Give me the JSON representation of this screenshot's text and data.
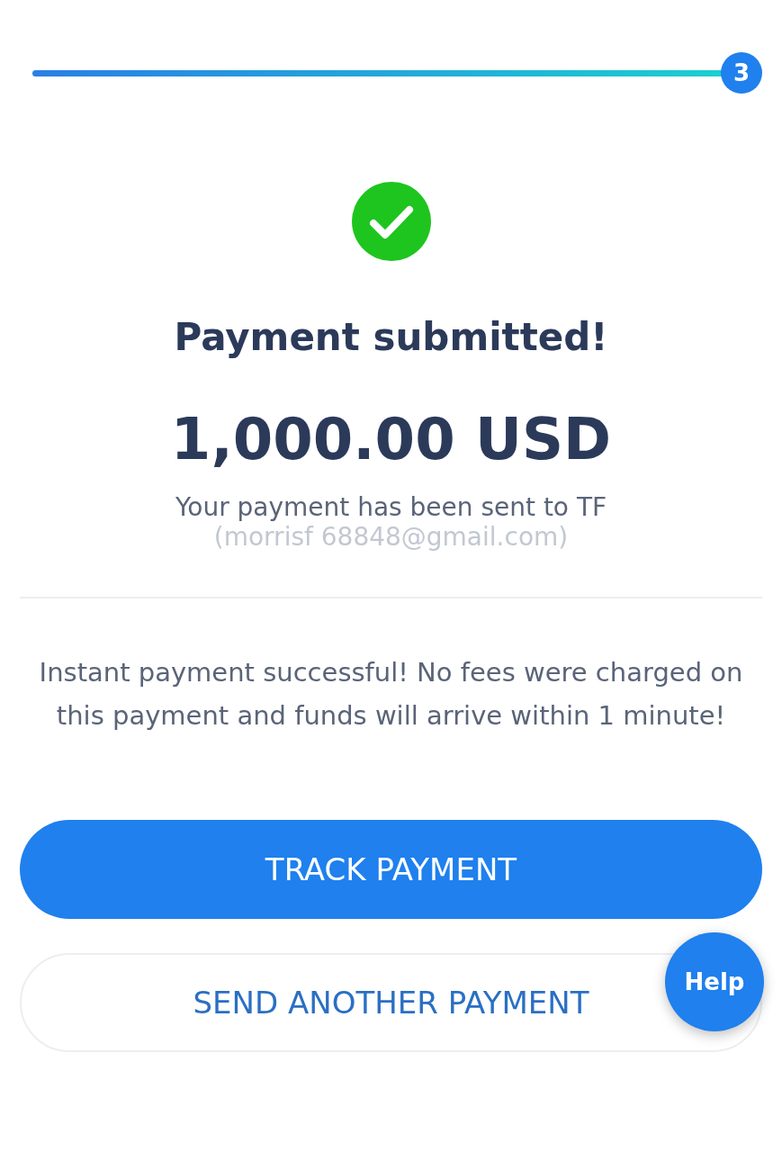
{
  "progress": {
    "level": 1,
    "step": "3"
  },
  "status": {
    "kind": "success",
    "title": "Payment submitted!",
    "amount": "1,000.00 USD",
    "recipient": "Your payment has been sent to TF",
    "email": "(morrisf 68848@gmail.com)"
  },
  "message": "Instant payment successful! No fees were charged on this payment and funds will arrive within 1 minute!",
  "buttons": [
    {
      "label": "TRACK PAYMENT",
      "kind": "primary"
    },
    {
      "label": "SEND ANOTHER PAYMENT",
      "kind": "secondary"
    }
  ],
  "help": {
    "label": "Help"
  }
}
